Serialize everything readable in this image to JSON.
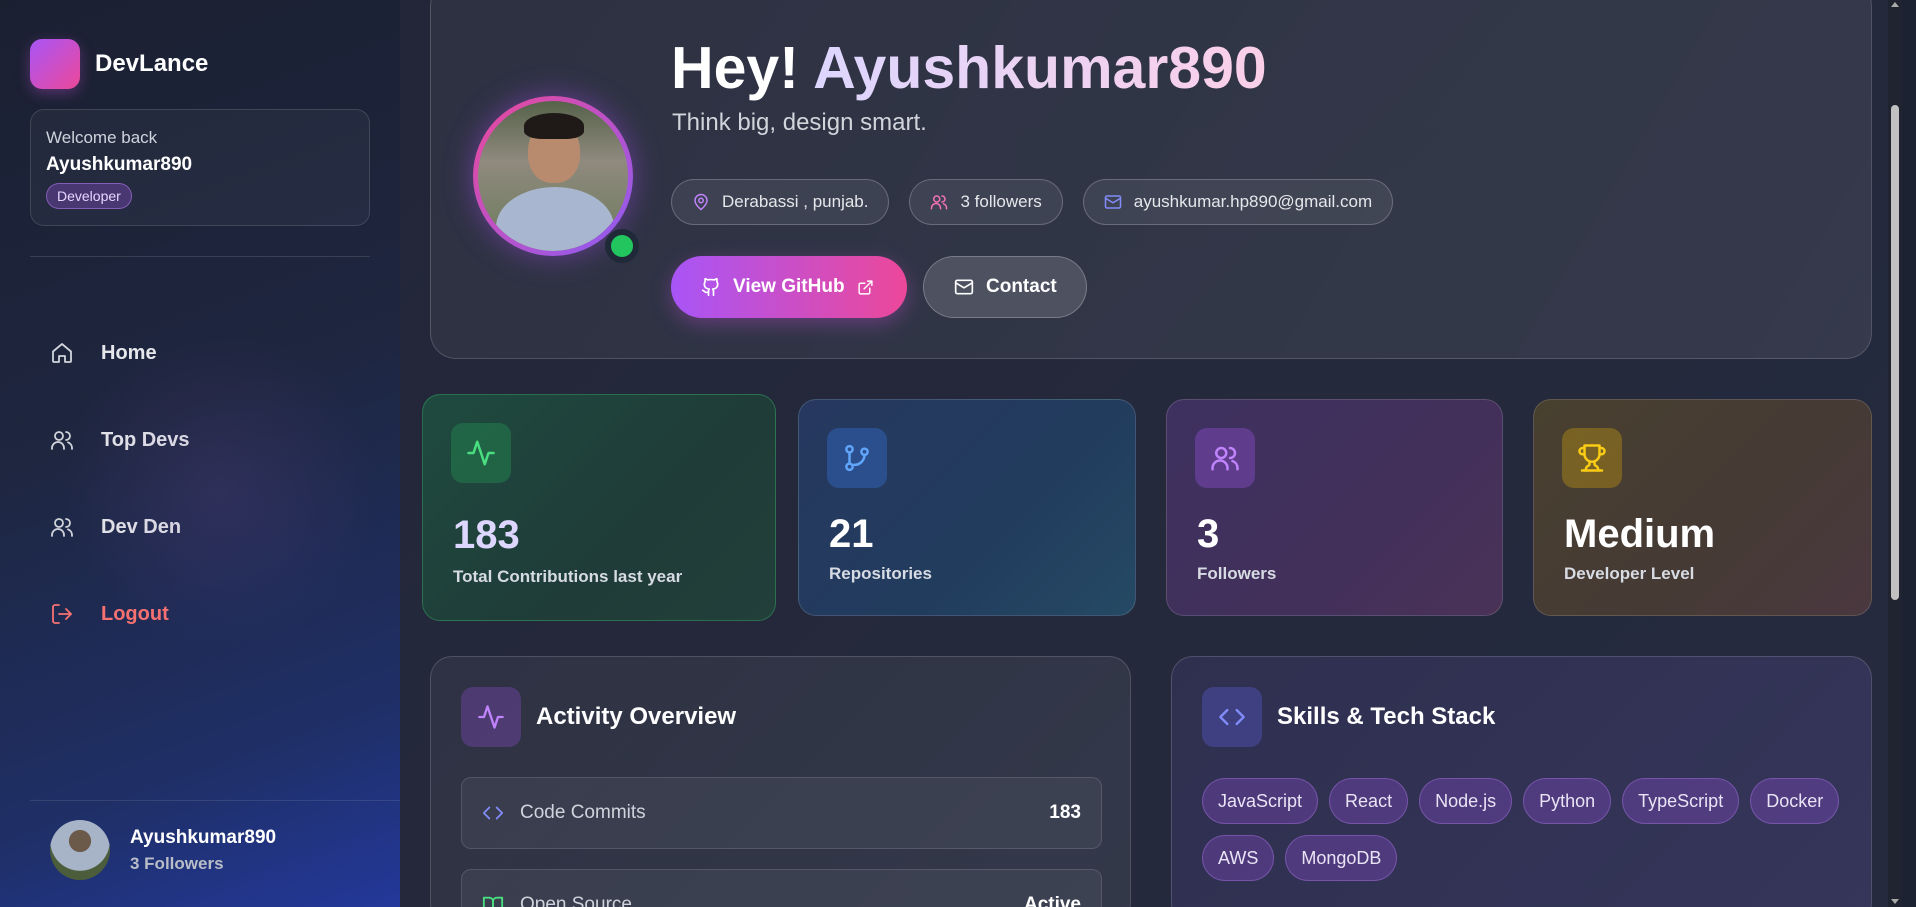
{
  "brand": {
    "name": "DevLance"
  },
  "welcome": {
    "greeting": "Welcome back",
    "username": "Ayushkumar890",
    "role": "Developer"
  },
  "nav": [
    {
      "label": "Home",
      "icon": "home-icon"
    },
    {
      "label": "Top Devs",
      "icon": "users-icon"
    },
    {
      "label": "Dev Den",
      "icon": "users-icon"
    },
    {
      "label": "Logout",
      "icon": "logout-icon"
    }
  ],
  "footer_user": {
    "name": "Ayushkumar890",
    "followers": "3 Followers"
  },
  "hero": {
    "greeting": "Hey!",
    "username": "Ayushkumar890",
    "tagline": "Think big, design smart.",
    "location": "Derabassi , punjab.",
    "followers": "3 followers",
    "email": "ayushkumar.hp890@gmail.com",
    "github_button": "View GitHub",
    "contact_button": "Contact"
  },
  "stats": {
    "contributions": {
      "value": "183",
      "label": "Total Contributions last year"
    },
    "repositories": {
      "value": "21",
      "label": "Repositories"
    },
    "followers": {
      "value": "3",
      "label": "Followers"
    },
    "level": {
      "value": "Medium",
      "label": "Developer Level"
    }
  },
  "activity": {
    "title": "Activity Overview",
    "rows": [
      {
        "name": "Code Commits",
        "value": "183"
      },
      {
        "name": "Open Source",
        "value": "Active"
      }
    ]
  },
  "skills": {
    "title": "Skills & Tech Stack",
    "tags": [
      "JavaScript",
      "React",
      "Node.js",
      "Python",
      "TypeScript",
      "Docker",
      "AWS",
      "MongoDB"
    ]
  },
  "colors": {
    "accent_purple": "#a855f7",
    "accent_pink": "#ec4899",
    "online_green": "#22c55e",
    "logout_red": "#f87171"
  }
}
